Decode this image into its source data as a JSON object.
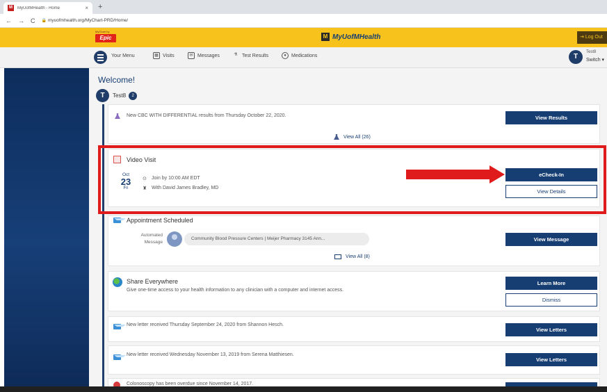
{
  "browser": {
    "tab_title": "MyUofMHealth - Home",
    "tab_close": "×",
    "new_tab": "+",
    "back": "←",
    "forward": "→",
    "reload": "C",
    "url": "myuofmhealth.org/MyChart-PRD/Home/"
  },
  "header": {
    "epic_small": "MyChart by",
    "epic_logo": "Epic",
    "brand_mark": "M",
    "brand_name": "MyUofMHealth",
    "logout_label": "Log Out"
  },
  "menu": {
    "your_menu": "Your Menu",
    "items": [
      {
        "label": "Visits",
        "icon": "calendar-icon"
      },
      {
        "label": "Messages",
        "icon": "envelope-icon"
      },
      {
        "label": "Test Results",
        "icon": "flask-icon"
      },
      {
        "label": "Medications",
        "icon": "pills-icon"
      }
    ],
    "user_initial": "T",
    "user_name": "Test8",
    "switch_label": "Switch ▾"
  },
  "welcome": {
    "title": "Welcome!",
    "profile_initial": "T",
    "profile_name": "Test8",
    "profile_badge": "2"
  },
  "cards": {
    "results": {
      "text": "New CBC WITH DIFFERENTIAL results from Thursday October 22, 2020.",
      "button": "View Results",
      "view_all": "View All (26)"
    },
    "video_visit": {
      "title": "Video Visit",
      "month": "Oct",
      "day": "23",
      "weekday": "Fri",
      "join_time": "Join by 10:00 AM EDT",
      "provider": "With David James Bradley, MD",
      "checkin_button": "eCheck-In",
      "details_button": "View Details"
    },
    "appointment": {
      "title": "Appointment Scheduled",
      "automated_label_1": "Automated",
      "automated_label_2": "Message",
      "pill": "Community Blood Pressure Centers | Meijer Pharmacy 3145 Ann...",
      "button": "View Message",
      "view_all": "View All (8)"
    },
    "share": {
      "title": "Share Everywhere",
      "text": "Give one-time access to your health information to any clinician with a computer and internet access.",
      "learn_more": "Learn More",
      "dismiss": "Dismiss"
    },
    "letter1": {
      "text": "New letter received Thursday September 24, 2020 from Shannon Hesch.",
      "button": "View Letters"
    },
    "letter2": {
      "text": "New letter received Wednesday November 13, 2019 from Serena Matthiesen.",
      "button": "View Letters"
    },
    "overdue": {
      "text": "Colonoscopy has been overdue since November 14, 2017."
    }
  },
  "colors": {
    "header_yellow": "#f6c21b",
    "navy": "#173e73",
    "highlight_red": "#e01b1b"
  }
}
